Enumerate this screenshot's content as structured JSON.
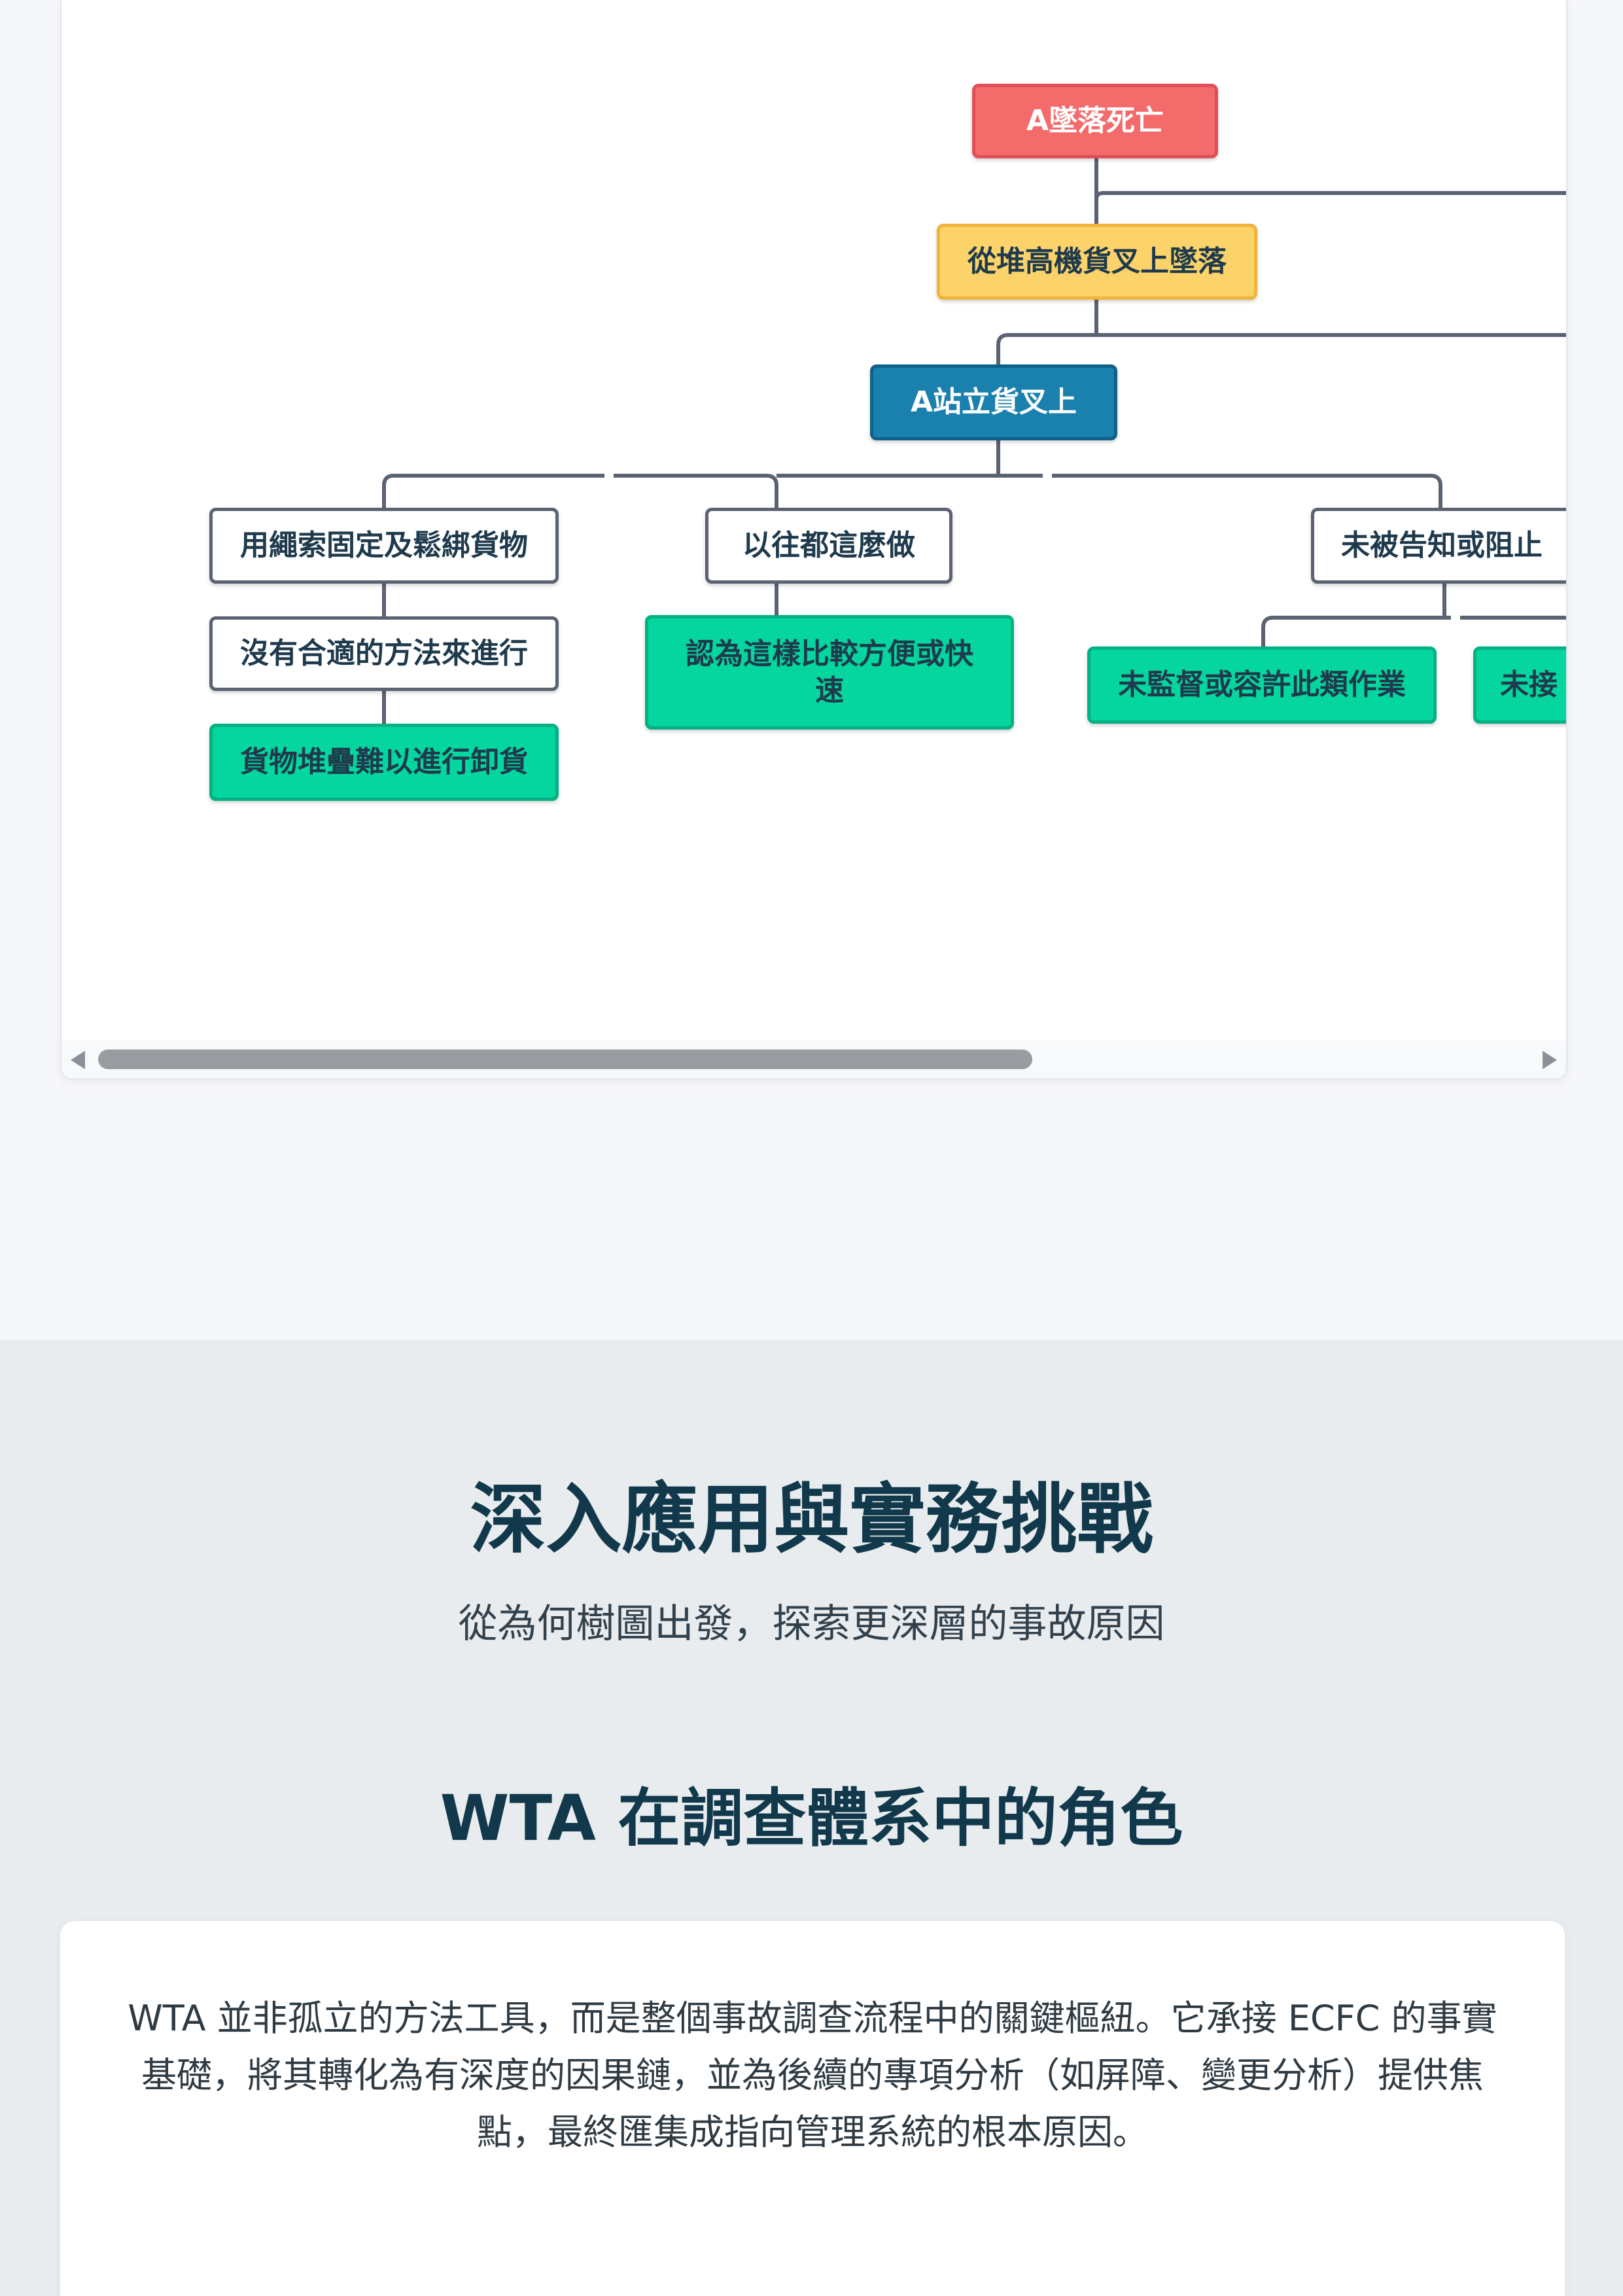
{
  "tree": {
    "nodes": {
      "root": "A墜落死亡",
      "level1": "從堆高機貨叉上墜落",
      "level2": "A站立貨叉上",
      "cause_a": "用繩索固定及鬆綁貨物",
      "cause_a_1": "沒有合適的方法來進行",
      "cause_a_2": "貨物堆疊難以進行卸貨",
      "cause_b": "以往都這麼做",
      "cause_b_1": "認為這樣比較方便或快速",
      "cause_c": "未被告知或阻止",
      "cause_c_1": "未監督或容許此類作業",
      "cause_c_2": "未接"
    },
    "colors": {
      "root": "#f36b6b",
      "level1": "#fcd36a",
      "level2": "#1a80ae",
      "white": "#ffffff",
      "leaf": "#05d59e",
      "connector": "#5b6271"
    },
    "scrollbar": {
      "position_fraction": 0.0
    }
  },
  "section": {
    "title": "深入應用與實務挑戰",
    "subtitle": "從為何樹圖出發，探索更深層的事故原因",
    "heading": "WTA 在調查體系中的角色",
    "paragraph": "WTA 並非孤立的方法工具，而是整個事故調查流程中的關鍵樞紐。它承接 ECFC 的事實基礎，將其轉化為有深度的因果鏈，並為後續的專項分析（如屏障、變更分析）提供焦點，最終匯集成指向管理系統的根本原因。"
  }
}
